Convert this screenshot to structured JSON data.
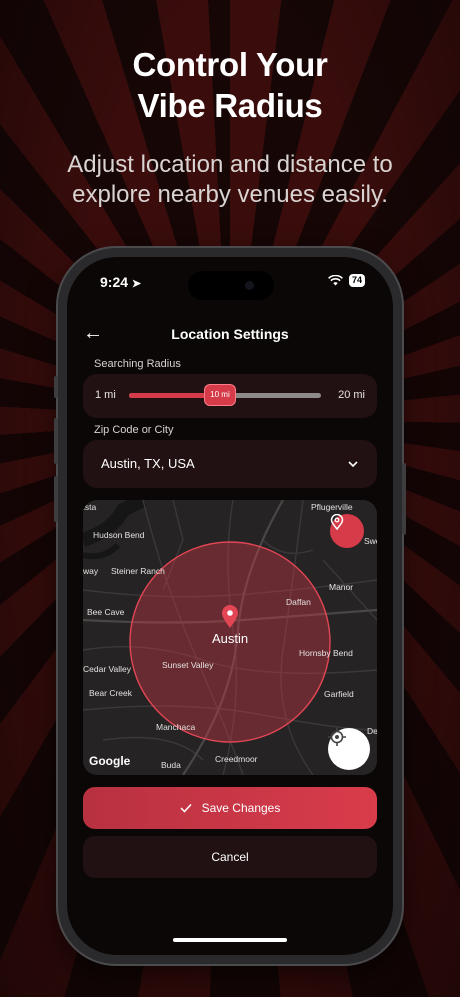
{
  "promo": {
    "title_line1": "Control Your",
    "title_line2": "Vibe Radius",
    "subtitle_line1": "Adjust location and distance to",
    "subtitle_line2": "explore nearby venues easily."
  },
  "status_bar": {
    "time": "9:24",
    "battery": "74",
    "icons": [
      "location-arrow-icon",
      "wifi-icon",
      "battery-icon"
    ]
  },
  "nav": {
    "title": "Location Settings",
    "back_icon": "arrow-left-icon"
  },
  "radius": {
    "label": "Searching Radius",
    "min_label": "1 mi",
    "max_label": "20 mi",
    "value_label": "10 mi",
    "value": 10,
    "min": 1,
    "max": 20
  },
  "location": {
    "label": "Zip Code or City",
    "value": "Austin, TX, USA",
    "chevron_icon": "chevron-down-icon"
  },
  "map": {
    "center_label": "Austin",
    "attribution": "Google",
    "places": [
      "Pflugerville",
      "Hudson Bend",
      "Steiner Ranch",
      "Manor",
      "Bee Cave",
      "Daffan",
      "Hornsby Bend",
      "Cedar Valley",
      "Sunset Valley",
      "Bear Creek",
      "Garfield",
      "Manchaca",
      "Creedmoor",
      "Buda"
    ],
    "edge_labels": [
      "ista",
      "Swe",
      "way",
      "Del"
    ],
    "accent": "#d63b49"
  },
  "actions": {
    "save_label": "Save Changes",
    "cancel_label": "Cancel"
  },
  "colors": {
    "accent": "#d63b49",
    "card": "#221112",
    "screen_bg": "#0c0707"
  }
}
